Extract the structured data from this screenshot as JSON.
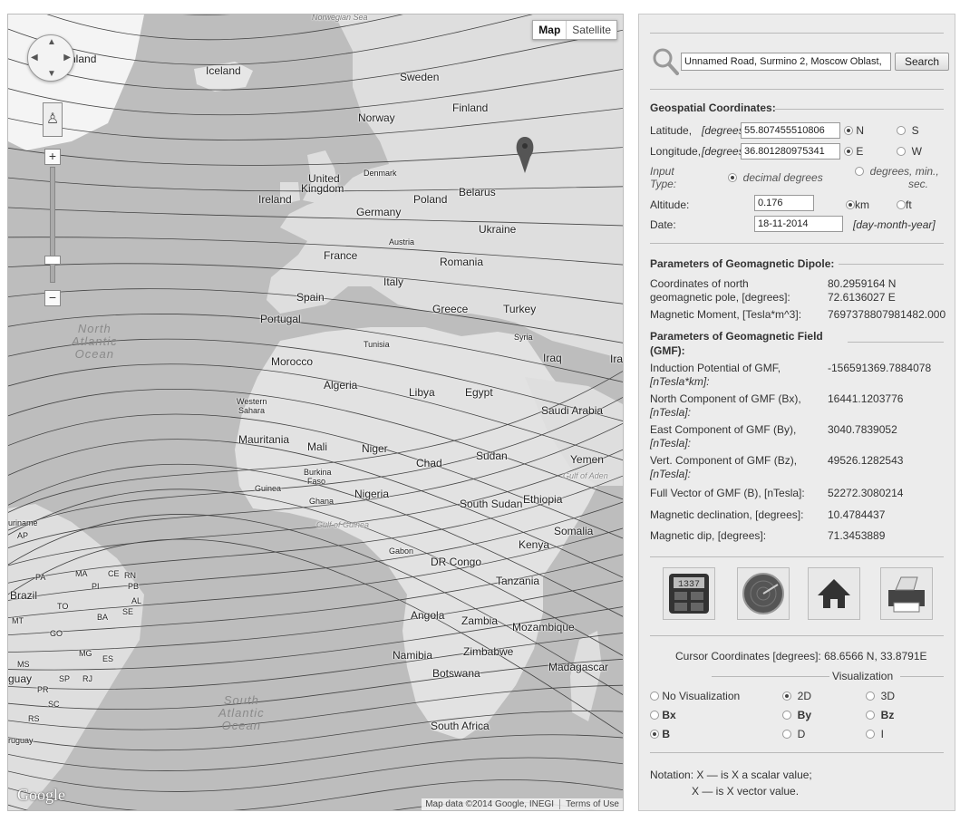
{
  "map": {
    "type_buttons": [
      "Map",
      "Satellite"
    ],
    "active_type": "Map",
    "labels": {
      "norwegian_sea": "Norwegian Sea",
      "greenland": "nland",
      "iceland": "Iceland",
      "sweden": "Sweden",
      "finland": "Finland",
      "norway": "Norway",
      "denmark": "Denmark",
      "united_kingdom_1": "United",
      "united_kingdom_2": "Kingdom",
      "ireland": "Ireland",
      "poland": "Poland",
      "belarus": "Belarus",
      "germany": "Germany",
      "ukraine": "Ukraine",
      "austria": "Austria",
      "france": "France",
      "romania": "Romania",
      "italy": "Italy",
      "spain": "Spain",
      "portugal": "Portugal",
      "greece": "Greece",
      "turkey": "Turkey",
      "syria": "Syria",
      "iraq": "Iraq",
      "ira": "Ira",
      "tunisia": "Tunisia",
      "morocco": "Morocco",
      "algeria": "Algeria",
      "libya": "Libya",
      "egypt": "Egypt",
      "saudi_arabia": "Saudi Arabia",
      "western_sahara_1": "Western",
      "western_sahara_2": "Sahara",
      "mauritania": "Mauritania",
      "mali": "Mali",
      "niger": "Niger",
      "chad": "Chad",
      "sudan": "Sudan",
      "yemen": "Yemen",
      "gulf_of_aden": "Gulf of Aden",
      "burkina_1": "Burkina",
      "burkina_2": "Faso",
      "guinea": "Guinea",
      "ghana": "Ghana",
      "nigeria": "Nigeria",
      "south_sudan": "South Sudan",
      "ethiopia": "Ethiopia",
      "somalia": "Somalia",
      "gulf_of_guinea": "Gulf of Guinea",
      "gabon": "Gabon",
      "kenya": "Kenya",
      "dr_congo": "DR Congo",
      "tanzania": "Tanzania",
      "angola": "Angola",
      "zambia": "Zambia",
      "mozambique": "Mozambique",
      "namibia": "Namibia",
      "zimbabwe": "Zimbabwe",
      "botswana": "Botswana",
      "madagascar": "Madagascar",
      "south_africa": "South Africa",
      "suriname": "uriname",
      "ap": "AP",
      "pa": "PA",
      "ma": "MA",
      "ce": "CE",
      "rn": "RN",
      "pi": "PI",
      "pb": "PB",
      "brazil": "Brazil",
      "al": "AL",
      "to": "TO",
      "se": "SE",
      "ba": "BA",
      "mt": "MT",
      "go": "GO",
      "mg": "MG",
      "es": "ES",
      "ms": "MS",
      "sp": "SP",
      "rj": "RJ",
      "pr": "PR",
      "uay": "guay",
      "sc": "SC",
      "rs": "RS",
      "ruguay": "ruguay",
      "north_atlantic_1": "North",
      "north_atlantic_2": "Atlantic",
      "north_atlantic_3": "Ocean",
      "south_atlantic_1": "South",
      "south_atlantic_2": "Atlantic",
      "south_atlantic_3": "Ocean"
    },
    "logo": "Google",
    "attribution": "Map data ©2014 Google, INEGI",
    "terms": "Terms of Use"
  },
  "search": {
    "value": "Unnamed Road, Surmino 2, Moscow Oblast,",
    "button": "Search"
  },
  "geo": {
    "heading": "Geospatial Coordinates:",
    "latitude_label": "Latitude,",
    "latitude_unit": "[degrees]:",
    "latitude_value": "55.807455510806",
    "lat_n": "N",
    "lat_s": "S",
    "longitude_label": "Longitude,",
    "longitude_unit": "[degrees]:",
    "longitude_value": "36.801280975341",
    "lon_e": "E",
    "lon_w": "W",
    "input_type_1": "Input",
    "input_type_2": "Type:",
    "decimal_degrees": "decimal degrees",
    "dms_1": "degrees, min.,",
    "dms_2": "sec.",
    "altitude_label": "Altitude:",
    "altitude_value": "0.176",
    "km": "km",
    "ft": "ft",
    "date_label": "Date:",
    "date_value": "18-11-2014",
    "date_format": "[day-month-year]"
  },
  "dipole": {
    "heading": "Parameters of Geomagnetic Dipole:",
    "pole_label_1": "Coordinates of north",
    "pole_label_2": "geomagnetic pole, [degrees]:",
    "pole_lat": "80.2959164 N",
    "pole_lon": "72.6136027 E",
    "moment_label": "Magnetic Moment, [Tesla*m^3]:",
    "moment_value": "7697378807981482.000"
  },
  "gmf": {
    "heading_1": "Parameters of Geomagnetic Field",
    "heading_2": "(GMF):",
    "potential_label_1": "Induction Potential of GMF,",
    "potential_label_2": "[nTesla*km]:",
    "potential_value": "-156591369.7884078",
    "north_label_1": "North Component of GMF (Bx),",
    "north_label_2": "[nTesla]:",
    "north_value": "16441.1203776",
    "east_label_1": "East Component of GMF (By),",
    "east_label_2": "[nTesla]:",
    "east_value": "3040.7839052",
    "vert_label_1": "Vert. Component of GMF (Bz),",
    "vert_label_2": "[nTesla]:",
    "vert_value": "49526.1282543",
    "full_label": "Full Vector of GMF (B), [nTesla]:",
    "full_value": "52272.3080214",
    "decl_label": "Magnetic declination, [degrees]:",
    "decl_value": "10.4784437",
    "dip_label": "Magnetic dip, [degrees]:",
    "dip_value": "71.3453889"
  },
  "toolbar": {
    "calculator_display": "1337"
  },
  "cursor": {
    "label": "Cursor Coordinates [degrees]:",
    "value": "68.6566 N, 33.8791E"
  },
  "visualization": {
    "heading": "Visualization",
    "options": [
      "No Visualization",
      "2D",
      "3D",
      "Bx",
      "By",
      "Bz",
      "B",
      "D",
      "I"
    ],
    "selected": [
      "2D",
      "B"
    ]
  },
  "notation": {
    "line1": "Notation: X — is X a scalar value;",
    "line2": "X — is X vector value."
  },
  "colors": {
    "panel_bg": "#ececec",
    "map_land": "#d9d9d9",
    "map_water": "#b9b9b9",
    "isoline": "#444444"
  }
}
